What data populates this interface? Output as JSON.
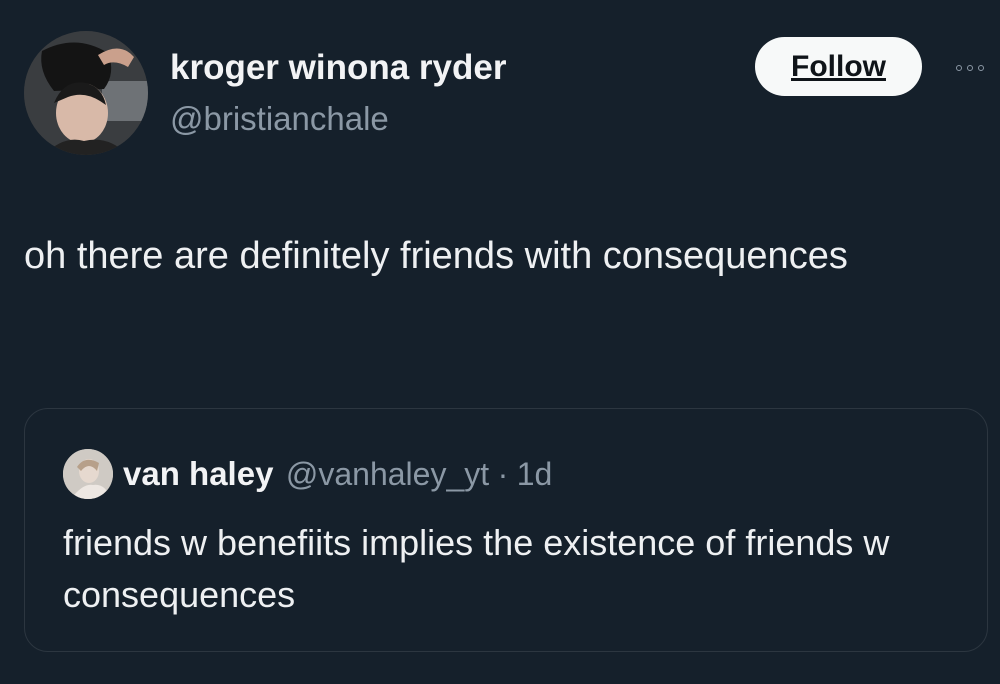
{
  "tweet": {
    "author": {
      "display_name": "kroger winona ryder",
      "handle": "@bristianchale",
      "avatar_icon": "profile-photo"
    },
    "follow_label": "Follow",
    "more_icon": "ellipsis-icon",
    "text": "oh there are definitely friends with consequences"
  },
  "quoted_tweet": {
    "author": {
      "display_name": "van haley",
      "handle": "@vanhaley_yt",
      "separator": "·",
      "age": "1d",
      "avatar_icon": "profile-photo"
    },
    "text": "friends w benefiits implies the existence of friends w consequences"
  },
  "colors": {
    "background": "#15202b",
    "primary_text": "#e7e9ea",
    "secondary_text": "#8b98a5",
    "follow_button_bg": "#f7f9f9",
    "card_border": "#2c3640"
  }
}
